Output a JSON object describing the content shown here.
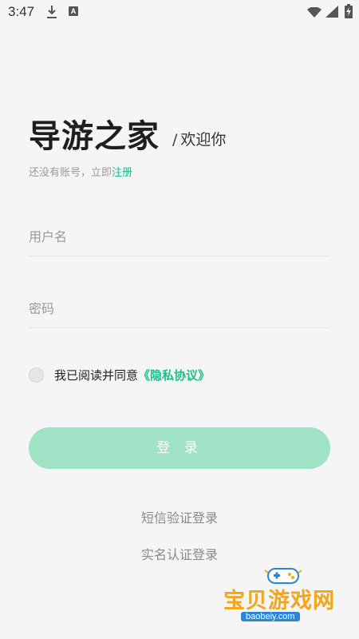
{
  "status_bar": {
    "time": "3:47",
    "a_badge": "A"
  },
  "header": {
    "title": "导游之家",
    "slash": "/",
    "subtitle": "欢迎你",
    "register_prompt": "还没有账号，立即",
    "register_link": "注册"
  },
  "form": {
    "username_placeholder": "用户名",
    "password_placeholder": "密码",
    "agree_text": "我已阅读并同意",
    "privacy_link": "《隐私协议》",
    "login_label": "登 录"
  },
  "alt_logins": {
    "sms": "短信验证登录",
    "realname": "实名认证登录"
  },
  "watermark": {
    "text": "宝贝游戏网",
    "url": "baobeiy.com"
  },
  "colors": {
    "accent": "#19c28a",
    "button": "#9fe2c6",
    "background": "#f5f5f5"
  }
}
